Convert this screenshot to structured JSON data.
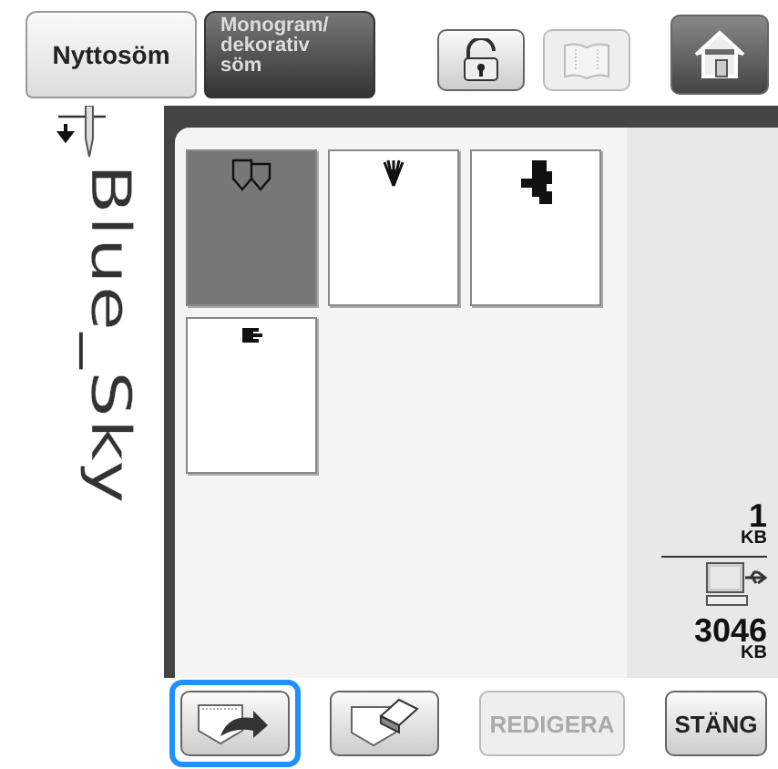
{
  "tabs": [
    {
      "label": "Nyttosöm",
      "selected": false
    },
    {
      "label": "Monogram/\ndekorativ\nsöm",
      "selected": true
    }
  ],
  "toolbar": [
    {
      "kind": "lock",
      "disabled": false
    },
    {
      "kind": "manual",
      "disabled": true
    },
    {
      "kind": "home",
      "disabled": false
    }
  ],
  "pattern_name": "Blue_Sky",
  "patterns": [
    {
      "kind": "shield",
      "selected": true
    },
    {
      "kind": "plant",
      "selected": false
    },
    {
      "kind": "splat",
      "selected": false
    },
    {
      "kind": "block",
      "selected": false
    }
  ],
  "memory": {
    "used": "1",
    "used_unit": "KB",
    "free": "3046",
    "free_unit": "KB"
  },
  "buttons": [
    {
      "kind": "retrieve",
      "focused": true,
      "disabled": false
    },
    {
      "kind": "delete",
      "focused": false,
      "disabled": false
    },
    {
      "kind": "text",
      "label": "REDIGERA",
      "focused": false,
      "disabled": true
    },
    {
      "kind": "text",
      "label": "STÄNG",
      "focused": false,
      "disabled": false
    }
  ]
}
